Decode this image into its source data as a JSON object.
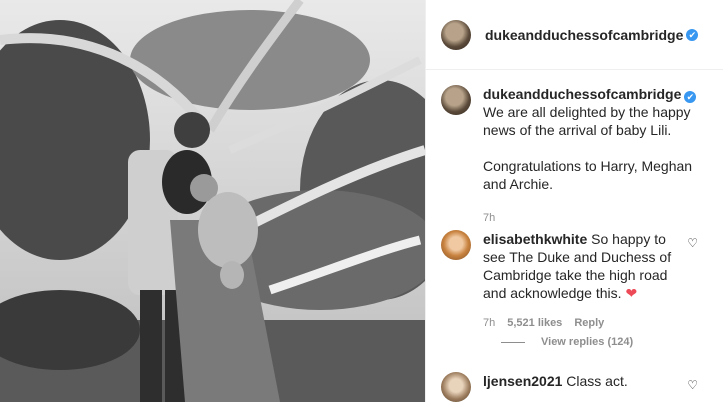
{
  "header": {
    "username": "dukeandduchessofcambridge",
    "verified": true
  },
  "caption": {
    "username": "dukeandduchessofcambridge",
    "paragraph1": "We are all delighted by the happy news of the arrival of baby Lili.",
    "paragraph2": "Congratulations to Harry, Meghan and Archie.",
    "time": "7h"
  },
  "comments": [
    {
      "username": "elisabethkwhite",
      "text": "So happy to see The Duke and Duchess of Cambridge take the high road and acknowledge this.",
      "emoji": "❤",
      "time": "7h",
      "likes": "5,521 likes",
      "reply_label": "Reply",
      "view_replies": "View replies (124)"
    },
    {
      "username": "ljensen2021",
      "text": "Class act."
    }
  ],
  "icons": {
    "verified": "✔",
    "like": "♡"
  },
  "colors": {
    "verified": "#3897f0",
    "heart": "#ed4956",
    "meta": "#8e8e8e"
  }
}
